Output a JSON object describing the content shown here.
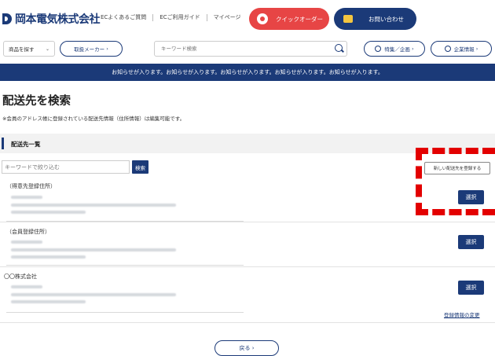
{
  "header": {
    "logo_text": "岡本電気株式会社",
    "links": [
      "ECよくあるご質問",
      "ECご利用ガイド",
      "マイページ"
    ],
    "quick_order_label": "クイックオーダー",
    "contact_label": "お問い合わせ"
  },
  "nav": {
    "category_select_value": "商品を探す",
    "maker_label": "取扱メーカー",
    "search_placeholder": "キーワード検索",
    "special_label": "特集／企画",
    "company_label": "企業情報"
  },
  "notice_text": "お知らせが入ります。お知らせが入ります。お知らせが入ります。お知らせが入ります。お知らせが入ります。",
  "page": {
    "title": "配送先を検索",
    "note": "※会員のアドレス帳に登録されている配送先情報（住所情報）は編集可能です。",
    "section_title": "配送先一覧",
    "keyword_placeholder": "キーワードで絞り込む",
    "search_button": "検索",
    "new_address_button": "新しい配送先を登録する"
  },
  "entries": [
    {
      "title": "（得意先登録住所）",
      "select_label": "選択"
    },
    {
      "title": "（会員登録住所）",
      "select_label": "選択"
    },
    {
      "title": "〇〇株式会社",
      "select_label": "選択"
    }
  ],
  "edit_registration_link": "登録情報の変更",
  "back_button": "戻る",
  "colors": {
    "brand_navy": "#1b3a78",
    "quick_red": "#e74545",
    "highlight_red": "#e30000"
  }
}
